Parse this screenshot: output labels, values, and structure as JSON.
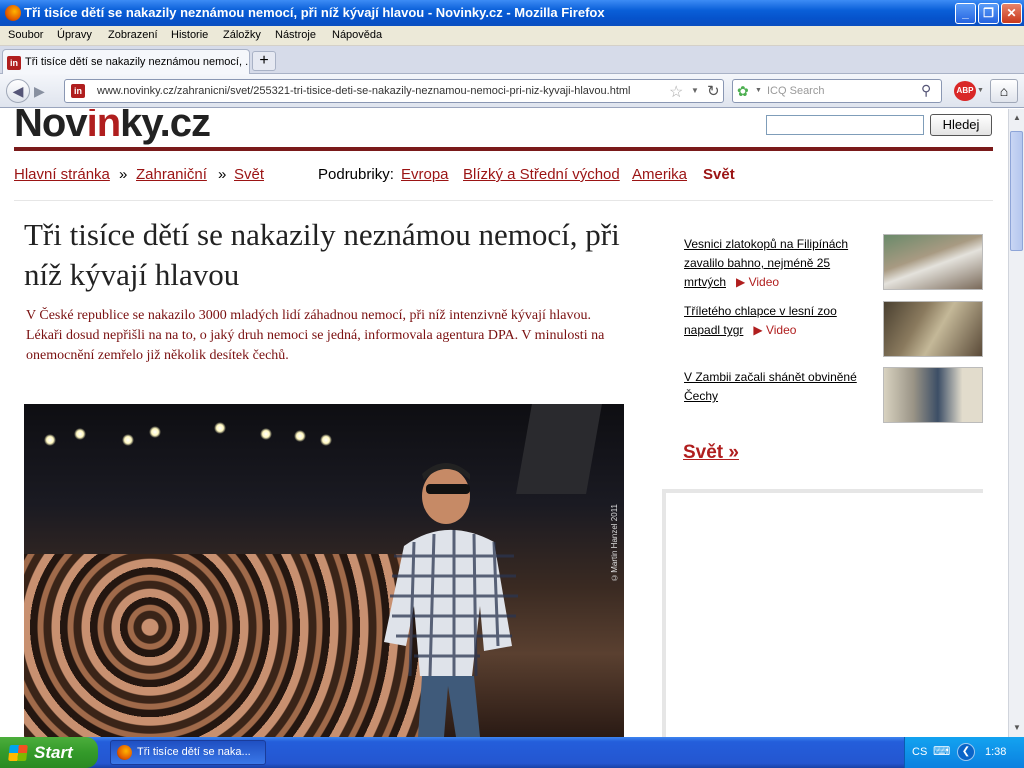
{
  "window": {
    "title": "Tři tisíce dětí se nakazily neznámou nemocí, při níž kývají hlavou  - Novinky.cz - Mozilla Firefox",
    "minimize": "_",
    "maximize": "❐",
    "close": "✕"
  },
  "menu": [
    "Soubor",
    "Úpravy",
    "Zobrazení",
    "Historie",
    "Záložky",
    "Nástroje",
    "Nápověda"
  ],
  "tab": {
    "label": "Tři tisíce dětí se nakazily neznámou nemocí, ...",
    "favicon": "in",
    "new_tab": "+"
  },
  "nav": {
    "url": "www.novinky.cz/zahranicni/svet/255321-tri-tisice-deti-se-nakazily-neznamou-nemoci-pri-niz-kyvaji-hlavou.html",
    "search_placeholder": "ICQ Search",
    "abp": "ABP"
  },
  "site": {
    "logo_pre": "Nov",
    "logo_red": "in",
    "logo_post": "ky.cz",
    "search_button": "Hledej"
  },
  "breadcrumb": {
    "home": "Hlavní stránka",
    "sep": "»",
    "section": "Zahraniční",
    "subsection": "Svět",
    "sub_label": "Podrubriky:",
    "subs": [
      "Evropa",
      "Blízký a Střední východ",
      "Amerika"
    ],
    "current": "Svět"
  },
  "article": {
    "headline": "Tři tisíce dětí se nakazily neznámou nemocí, při níž kývají hlavou",
    "perex": "V České republice se nakazilo 3000 mladých lidí záhadnou nemocí, při níž intenzivně kývají hlavou. Lékaři dosud nepřišli na na to, o jaký druh nemoci se jedná, informovala agentura DPA. V minulosti na onemocnění zemřelo již několik desítek čechů.",
    "photo_credit": "©Martin Hanzel 2011"
  },
  "sidebar": {
    "items": [
      {
        "title": "Vesnici zlatokopů na Filipínách zavalilo bahno, nejméně 25 mrtvých",
        "video": "Video"
      },
      {
        "title": "Tříletého chlapce v lesní zoo napadl tygr",
        "video": "Video"
      },
      {
        "title": "V Zambii začali shánět obviněné Čechy",
        "video": ""
      }
    ],
    "more": "Svět »"
  },
  "taskbar": {
    "start": "Start",
    "task": "Tři tisíce dětí se naka...",
    "lang": "CS",
    "clock": "1:38"
  },
  "colors": {
    "brand_red": "#b01e1e",
    "xp_blue": "#245edb"
  }
}
